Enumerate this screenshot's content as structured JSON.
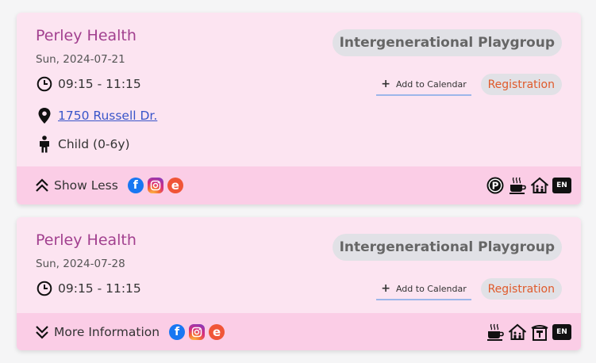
{
  "events": [
    {
      "organization": "Perley Health",
      "date": "Sun, 2024-07-21",
      "time": "09:15 - 11:15",
      "address": "1750 Russell Dr.",
      "age_group": "Child (0-6y)",
      "category": "Intergenerational Playgroup",
      "add_to_calendar": "Add to Calendar",
      "registration": "Registration",
      "toggle_label": "Show Less",
      "toggle_icon": "chevron-double-up-icon",
      "social": [
        "facebook-icon",
        "instagram-icon",
        "eventbrite-icon"
      ],
      "amenities": [
        "parking-icon",
        "coffee-icon",
        "indoor-home-icon"
      ],
      "language": "EN"
    },
    {
      "organization": "Perley Health",
      "date": "Sun, 2024-07-28",
      "time": "09:15 - 11:15",
      "category": "Intergenerational Playgroup",
      "add_to_calendar": "Add to Calendar",
      "registration": "Registration",
      "toggle_label": "More Information",
      "toggle_icon": "chevron-double-down-icon",
      "social": [
        "facebook-icon",
        "instagram-icon",
        "eventbrite-icon"
      ],
      "amenities": [
        "coffee-icon",
        "indoor-home-icon",
        "shelter-icon"
      ],
      "language": "EN"
    }
  ],
  "colors": {
    "card_bg": "#fce4f1",
    "footer_bg": "#fbcde6",
    "org_title": "#a2408f",
    "registration": "#e05a2b",
    "link": "#3955c9"
  }
}
